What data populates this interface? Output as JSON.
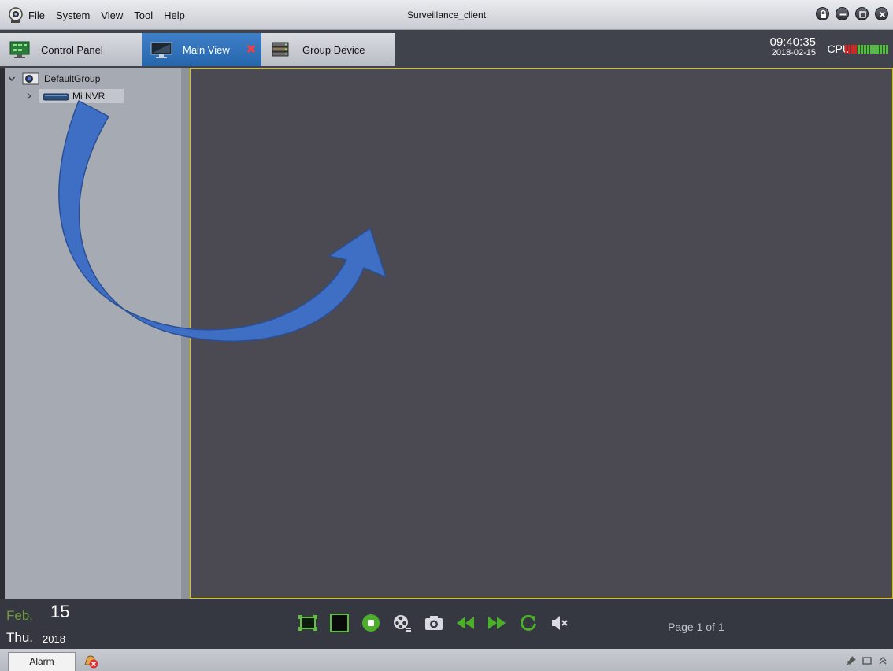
{
  "window": {
    "title": "Surveillance_client"
  },
  "menu": {
    "items": [
      "File",
      "System",
      "View",
      "Tool",
      "Help"
    ]
  },
  "window_buttons": [
    "lock-icon",
    "minimize-icon",
    "maximize-icon",
    "close-icon"
  ],
  "tabs": [
    {
      "label": "Control Panel",
      "icon": "control-panel-icon",
      "active": false
    },
    {
      "label": "Main View",
      "icon": "monitor-icon",
      "active": true,
      "closable": true
    },
    {
      "label": "Group Device",
      "icon": "group-device-icon",
      "active": false
    }
  ],
  "clock": {
    "time": "09:40:35",
    "date": "2018-02-15"
  },
  "cpu": {
    "label": "CPU",
    "level": 0.25
  },
  "tree": {
    "group": {
      "label": "DefaultGroup",
      "icon": "camera-group-icon",
      "expanded": true
    },
    "device": {
      "label": "Mi NVR",
      "icon": "nvr-icon",
      "selected": true,
      "expanded": false
    }
  },
  "date_block": {
    "month": "Feb.",
    "day": "15",
    "weekday": "Thu.",
    "year": "2018"
  },
  "controls": [
    "fullscreen-icon",
    "single-screen-icon",
    "stop-icon",
    "record-icon",
    "snapshot-icon",
    "rewind-icon",
    "fast-forward-icon",
    "refresh-icon",
    "mute-icon"
  ],
  "page_indicator": "Page 1 of 1",
  "status_bar": {
    "alarm_tab": "Alarm",
    "icons": [
      "pin-icon",
      "restore-icon",
      "collapse-icon"
    ]
  },
  "colors": {
    "accent": "#2566ad",
    "main_view_bg": "#4b4a52",
    "overlay_arrow": "#3f6fc4",
    "month_green": "#6f9a3a"
  }
}
